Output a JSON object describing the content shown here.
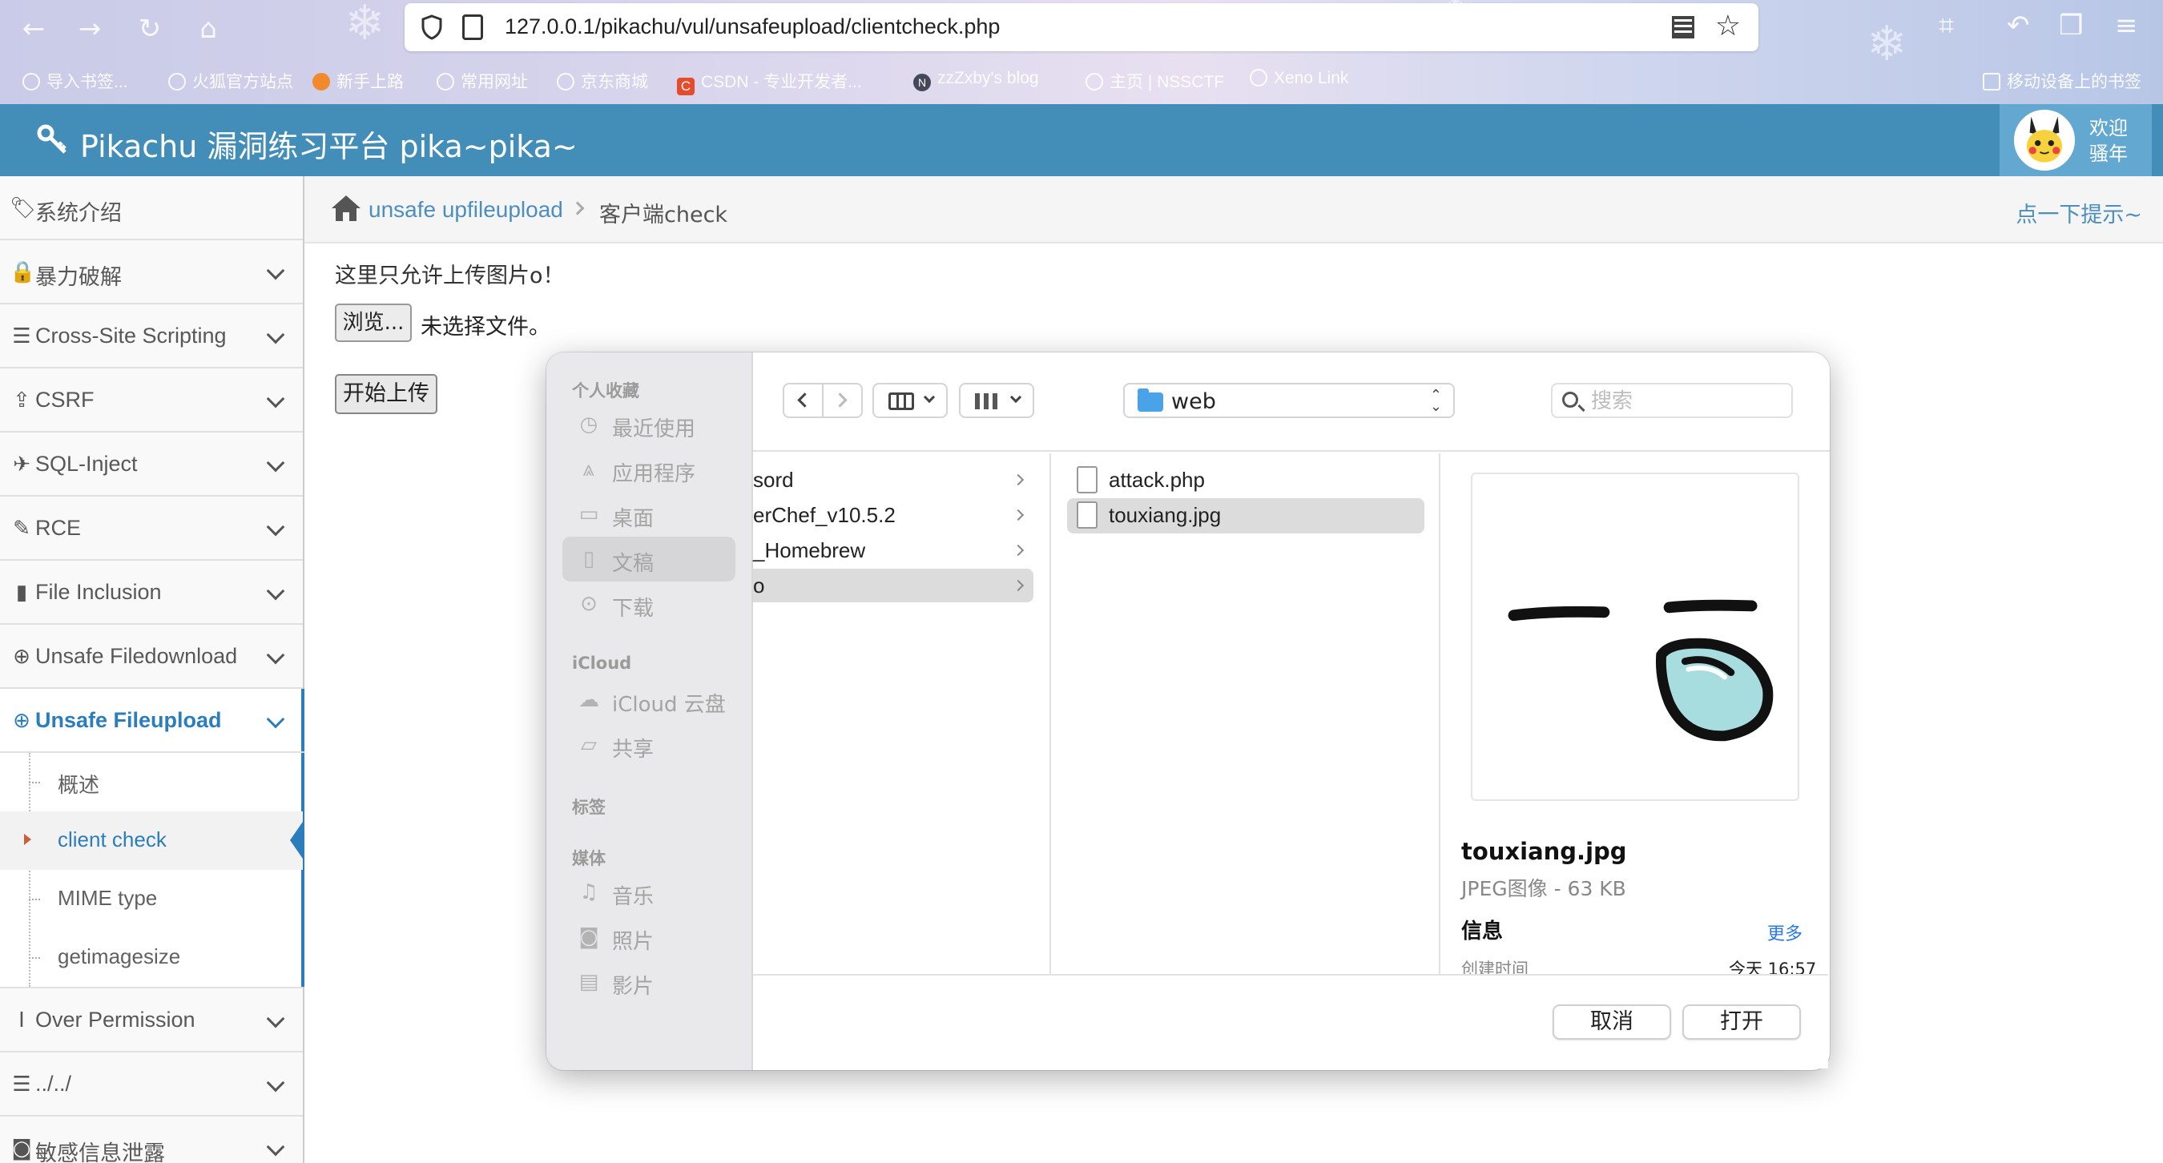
{
  "browser": {
    "url": "127.0.0.1/pikachu/vul/unsafeupload/clientcheck.php",
    "bookmarks": [
      "导入书签...",
      "火狐官方站点",
      "新手上路",
      "常用网址",
      "京东商城",
      "CSDN - 专业开发者...",
      "zzZxby's blog",
      "主页 | NSSCTF",
      "Xeno Link",
      "移动设备上的书签"
    ],
    "csdn_icon_letter": "C",
    "n_icon_letter": "N"
  },
  "header": {
    "title": "Pikachu 漏洞练习平台 pika~pika~",
    "welcome_line1": "欢迎",
    "welcome_line2": "骚年",
    "bar_color": "#438eb9"
  },
  "sidebar": {
    "items": [
      {
        "label": "系统介绍",
        "icon": "tags-icon"
      },
      {
        "label": "暴力破解",
        "icon": "lock-icon"
      },
      {
        "label": "Cross-Site Scripting",
        "icon": "list-icon"
      },
      {
        "label": "CSRF",
        "icon": "share-icon"
      },
      {
        "label": "SQL-Inject",
        "icon": "plane-icon"
      },
      {
        "label": "RCE",
        "icon": "pencil-icon"
      },
      {
        "label": "File Inclusion",
        "icon": "file-icon"
      },
      {
        "label": "Unsafe Filedownload",
        "icon": "download-icon"
      },
      {
        "label": "Unsafe Fileupload",
        "icon": "upload-icon"
      },
      {
        "label": "Over Permission",
        "icon": "text-cursor-icon"
      },
      {
        "label": "../../",
        "icon": "align-left-icon"
      },
      {
        "label": "敏感信息泄露",
        "icon": "camera-icon"
      }
    ],
    "sub_items": [
      "概述",
      "client check",
      "MIME type",
      "getimagesize"
    ]
  },
  "breadcrumb": {
    "crumb1": "unsafe upfileupload",
    "crumb2": "客户端check",
    "tip": "点一下提示~"
  },
  "main": {
    "note": "这里只允许上传图片o！",
    "browse_label": "浏览...",
    "no_file": "未选择文件。",
    "submit_label": "开始上传"
  },
  "dialog": {
    "sidebar": {
      "favorites_heading": "个人收藏",
      "favorites": [
        "最近使用",
        "应用程序",
        "桌面",
        "文稿",
        "下载"
      ],
      "icloud_heading": "iCloud",
      "icloud": [
        "iCloud 云盘",
        "共享"
      ],
      "tags_heading": "标签",
      "media_heading": "媒体",
      "media": [
        "音乐",
        "照片",
        "影片"
      ]
    },
    "location": "web",
    "search_placeholder": "搜索",
    "col1": [
      "sord",
      "erChef_v10.5.2",
      "_Homebrew",
      "o"
    ],
    "col2": [
      "attack.php",
      "touxiang.jpg"
    ],
    "preview": {
      "name": "touxiang.jpg",
      "kind": "JPEG图像 - 63 KB",
      "info": "信息",
      "more": "更多",
      "created_label": "创建时间",
      "created_value": "今天 16:57"
    },
    "cancel": "取消",
    "open": "打开"
  }
}
